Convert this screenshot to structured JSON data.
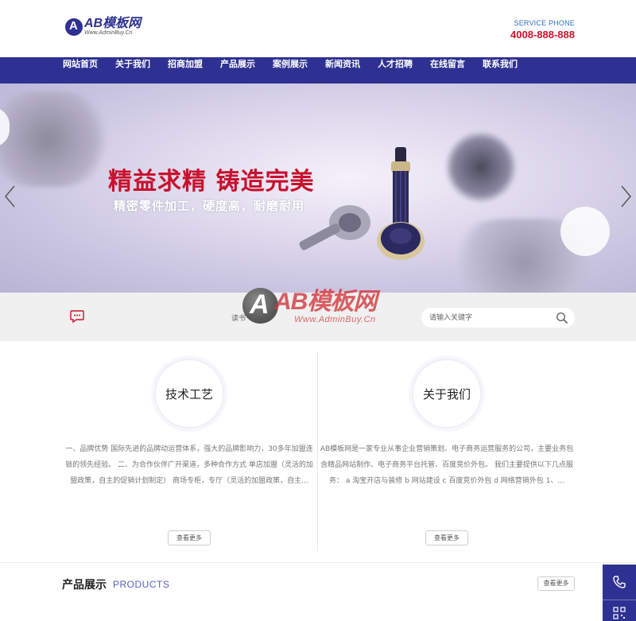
{
  "header": {
    "logo_title": "AB模板网",
    "logo_sub": "Www.AdminBuy.Cn",
    "service_label": "SERVICE PHONE",
    "service_phone": "4008-888-888"
  },
  "nav": {
    "items": [
      "网站首页",
      "关于我们",
      "招商加盟",
      "产品展示",
      "案例展示",
      "新闻资讯",
      "人才招聘",
      "在线留言",
      "联系我们"
    ]
  },
  "banner": {
    "title": "精益求精 铸造完美",
    "subtitle": "精密零件加工，硬度高，耐磨耐用"
  },
  "search": {
    "hotwords": "读书",
    "placeholder": "请输入关键字"
  },
  "watermark": {
    "title": "AB模板网",
    "sub": "Www.AdminBuy.Cn"
  },
  "intro": {
    "left": {
      "title": "技术工艺",
      "text": "一、品牌优势 国际先进的品牌动运营体系，强大的品牌影响力，30多年加盟连锁的领先经验。 二、为合作伙伴广开渠道，多种合作方式 单店加盟（灵活的加盟政策，自主的促销计划制定） 商场专柜，专厅（灵活的加盟政策，自主...",
      "more": "查看更多"
    },
    "right": {
      "title": "关于我们",
      "text": "AB模板网是一家专业从事企业营销策划、电子商务运营服务的公司，主要业务包含精品网站制作、电子商务平台托管、百度竞价外包。 我们主要提供以下几点服务： a 淘宝开店与装修 b 网站建设 c 百度竞价外包 d 网络营销外包 1、...",
      "more": "查看更多"
    }
  },
  "products": {
    "title": "产品展示",
    "title_en": "PRODUCTS",
    "more": "查看更多"
  },
  "colors": {
    "brand": "#2e3192",
    "accent_red": "#c8102e",
    "phone_red": "#d0142a"
  },
  "icons": {
    "message": "message-icon",
    "search": "search-icon",
    "phone": "phone-icon",
    "qr": "qrcode-icon"
  }
}
